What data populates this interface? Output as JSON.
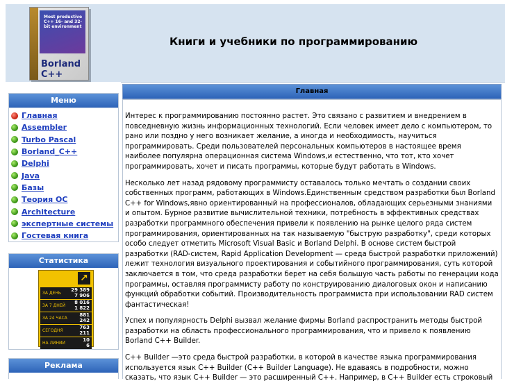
{
  "header": {
    "title": "Книги и учебники по программированию",
    "boxart_label": "Borland C++",
    "boxart_text": "Most productive C++ 16- and 32-bit environment"
  },
  "menu": {
    "title": "Меню",
    "items": [
      {
        "label": "Главная",
        "active": true
      },
      {
        "label": "Assembler"
      },
      {
        "label": "Turbo Pascal"
      },
      {
        "label": "Borland_C++"
      },
      {
        "label": "Delphi"
      },
      {
        "label": "Java"
      },
      {
        "label": "Базы"
      },
      {
        "label": "Теория ОС"
      },
      {
        "label": "Architecture"
      },
      {
        "label": "экспертные системы"
      },
      {
        "label": "Гостевая книга"
      }
    ]
  },
  "stats": {
    "title": "Статистика",
    "rows": [
      {
        "label": "ЗА ДЕНЬ",
        "v1": "29 389",
        "v2": "7 906"
      },
      {
        "label": "ЗА 7 ДНЕЙ",
        "v1": "8 016",
        "v2": "1 822"
      },
      {
        "label": "ЗА 24 ЧАСА",
        "v1": "881",
        "v2": "242"
      },
      {
        "label": "СЕГОДНЯ",
        "v1": "763",
        "v2": "211"
      },
      {
        "label": "НА ЛИНИИ",
        "v1": "10",
        "v2": "6"
      }
    ]
  },
  "ads": {
    "title": "Реклама"
  },
  "main": {
    "heading": "Главная",
    "paragraphs": [
      "Интерес к программированию постоянно растет. Это связано с развитием и внедрением в повседневную жизнь информационных технологий. Если человек имеет дело с компьютером, то рано или поздно у него возникает желание, а иногда и необходимость, научиться программировать. Среди пользователей персональных компьютеров в настоящее время наиболее популярна операционная система   Windows,и естественно, что тот, кто хочет программировать, хочет и писать программы, которые будут работать в Windows.",
      "Несколько лет назад рядовому программисту оставалось только мечтать о создании своих собственных программ, работающих в   Windows.Единственным средством разработки был Borland C++ for Windows,явно ориентированный на профессионалов, обладающих серьезными знаниями и опытом. Бурное развитие вычислительной техники, потребность в эффективных средствах разработки программного обеспечения привели к появлению на рынке целого ряда систем программирования, ориентированных на так называемую \"быструю разработку\", среди которых особо следует отметить Microsoft Visual Basic и Borland Delphi. В основе систем быстрой разработки (RAD-систем, Rapid Application Development — среда быстрой разработки приложений) лежит технология визуального проектирования и событийного программирования, суть которой заключается в том, что среда разработки берет на себя большую часть работы по генерации кода программы, оставляя программисту работу по конструированию диалоговых окон и написанию функций обработки событий. Производительность программиста при использовании RAD систем фантастическая!",
      "Успех и популярность  Delphi вызвал желание фирмы  Borland распространить методы быстрой разработки на область профессионального программирования, что и привело к появлению Borland C++ Builder.",
      "C++ Builder  —это среда быстрой разработки, в которой в качестве языка программирования используется язык  C++  Builder  (C++  Builder  Language). Не вдаваясь в подробности, можно сказать, что язык C++ Builder — это расширенный C++. Например, в C++ Builder есть строковый"
    ]
  }
}
